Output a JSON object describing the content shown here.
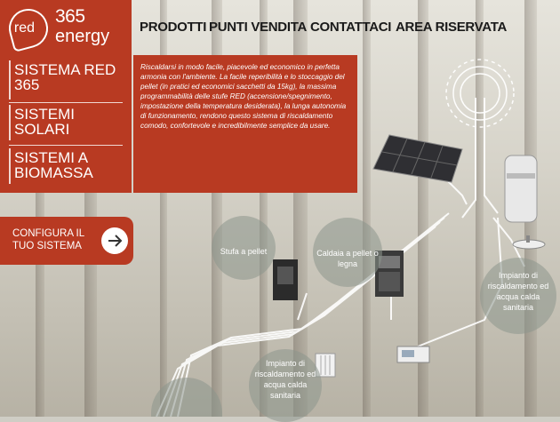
{
  "logo": {
    "red": "red",
    "number": "365",
    "energy": "energy"
  },
  "nav": {
    "items": [
      "PRODOTTI",
      "PUNTI VENDITA",
      "CONTATTACI",
      "AREA RISERVATA"
    ]
  },
  "sidebar": {
    "items": [
      {
        "line1": "SISTEMA RED",
        "line2": "365"
      },
      {
        "line1": "SISTEMI",
        "line2": "SOLARI"
      },
      {
        "line1": "SISTEMI A",
        "line2": "BIOMASSA"
      }
    ]
  },
  "description": "Riscaldarsi in modo facile, piacevole ed economico in perfetta armonia con l'ambiente. La facile reperibilità e lo stoccaggio del pellet (in pratici ed economici sacchetti da 15kg), la massima programmabilità delle stufe RED (accensione/spegnimento, impostazione della temperatura desiderata), la lunga autonomia di funzionamento, rendono questo sistema di riscaldamento comodo, confortevole e incredibilmente semplice da usare.",
  "configure": {
    "line1": "CONFIGURA IL",
    "line2": "TUO SISTEMA"
  },
  "bubbles": {
    "stufa": "Stufa a pellet",
    "caldaia_1": "Caldaia a pellet o",
    "caldaia_2": "legna",
    "impianto_right": [
      "Impianto di",
      "riscaldamento ed",
      "acqua calda",
      "sanitaria"
    ],
    "impianto_bottom": [
      "Impianto di",
      "riscaldamento ed",
      "acqua calda",
      "sanitaria"
    ]
  },
  "colors": {
    "brand_red": "#b83a22",
    "bubble": "#8c968c"
  }
}
